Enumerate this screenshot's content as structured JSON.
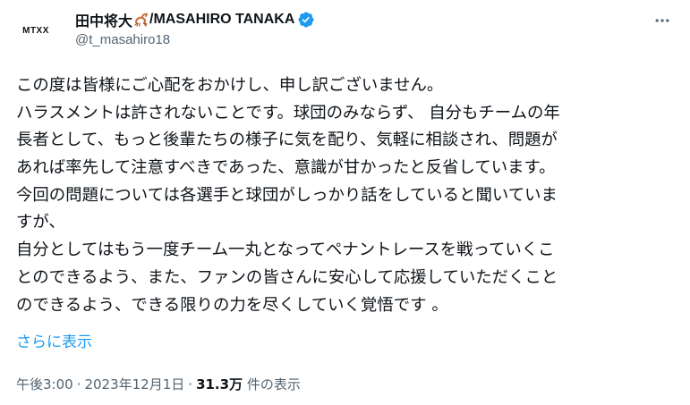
{
  "author": {
    "display_name": "田中将大",
    "display_name_suffix": "/MASAHIRO TANAKA",
    "handle": "@t_masahiro18",
    "avatar_text": "MTXX",
    "verified": true,
    "emoji_icon": "scorpion-icon"
  },
  "tweet": {
    "lines": [
      "この度は皆様にご心配をおかけし、申し訳ございません。",
      "ハラスメントは許されないことです。球団のみならず、 自分もチームの年",
      "長者として、もっと後輩たちの様子に気を配り、気軽に相談され、問題が",
      "あれば率先して注意すべきであった、意識が甘かったと反省しています。",
      "今回の問題については各選手と球団がしっかり話をしていると聞いていま",
      "すが、",
      "自分としてはもう一度チーム一丸となってペナントレースを戦っていくこ",
      "とのできるよう、また、ファンの皆さんに安心して応援していただくこと",
      "のできるよう、できる限りの力を尽くしていく覚悟です 。"
    ],
    "show_more_label": "さらに表示"
  },
  "meta": {
    "time": "午後3:00",
    "date": "2023年12月1日",
    "separator": "·",
    "views_count": "31.3万",
    "views_label": "件の表示"
  },
  "colors": {
    "text": "#0f1419",
    "secondary": "#536471",
    "accent": "#1d9bf0",
    "verified": "#1d9bf0"
  },
  "icons": {
    "more": "more-horizontal-icon",
    "verified": "verified-badge-icon",
    "emoji": "scorpion-icon"
  }
}
